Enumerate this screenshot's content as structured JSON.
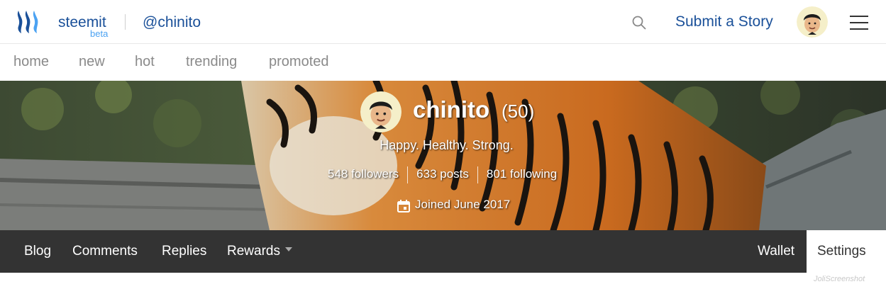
{
  "header": {
    "brand": "steemit",
    "brand_tag": "beta",
    "user_handle": "@chinito",
    "submit_label": "Submit a Story",
    "icons": [
      "steemit-logo-icon",
      "search-icon",
      "avatar",
      "hamburger-menu-icon"
    ]
  },
  "subnav": {
    "items": [
      "home",
      "new",
      "hot",
      "trending",
      "promoted"
    ]
  },
  "profile": {
    "name": "chinito",
    "reputation": "(50)",
    "about": "Happy. Healthy. Strong.",
    "followers": "548 followers",
    "posts": "633 posts",
    "following": "801 following",
    "joined": "Joined June 2017",
    "icons": [
      "calendar-icon"
    ]
  },
  "tabs": {
    "left": [
      "Blog",
      "Comments",
      "Replies",
      "Rewards"
    ],
    "right": [
      "Wallet",
      "Settings"
    ],
    "active": "Settings"
  },
  "watermark": "JoliScreenshot",
  "colors": {
    "brand_blue": "#1a5099",
    "beta_blue": "#4ba2f2",
    "nav_gray": "#8a8a8a",
    "tabbar": "#333333"
  }
}
